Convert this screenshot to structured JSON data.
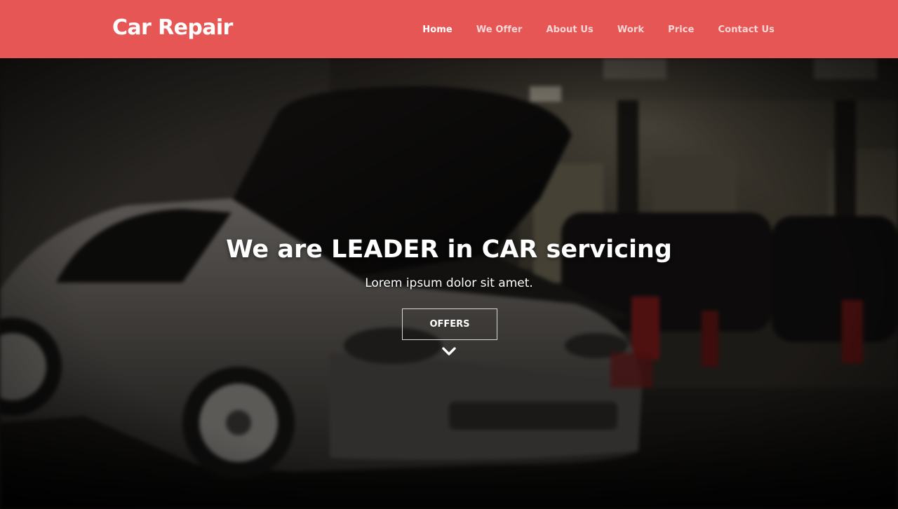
{
  "header": {
    "brand": "Car Repair",
    "nav": [
      {
        "label": "Home",
        "active": true
      },
      {
        "label": "We Offer",
        "active": false
      },
      {
        "label": "About Us",
        "active": false
      },
      {
        "label": "Work",
        "active": false
      },
      {
        "label": "Price",
        "active": false
      },
      {
        "label": "Contact Us",
        "active": false
      }
    ]
  },
  "hero": {
    "title": "We are LEADER in CAR servicing",
    "subtitle": "Lorem ipsum dolor sit amet.",
    "cta_label": "OFFERS",
    "scroll_icon": "chevron-down-icon",
    "background": "blurred photo of a silver sports car with its hood open in a dark garage"
  },
  "colors": {
    "navbar": "#e55655",
    "nav_text": "#f6d7d5",
    "nav_active": "#ffffff",
    "hero_text": "#ffffff",
    "button_border": "#d9d9d9"
  }
}
